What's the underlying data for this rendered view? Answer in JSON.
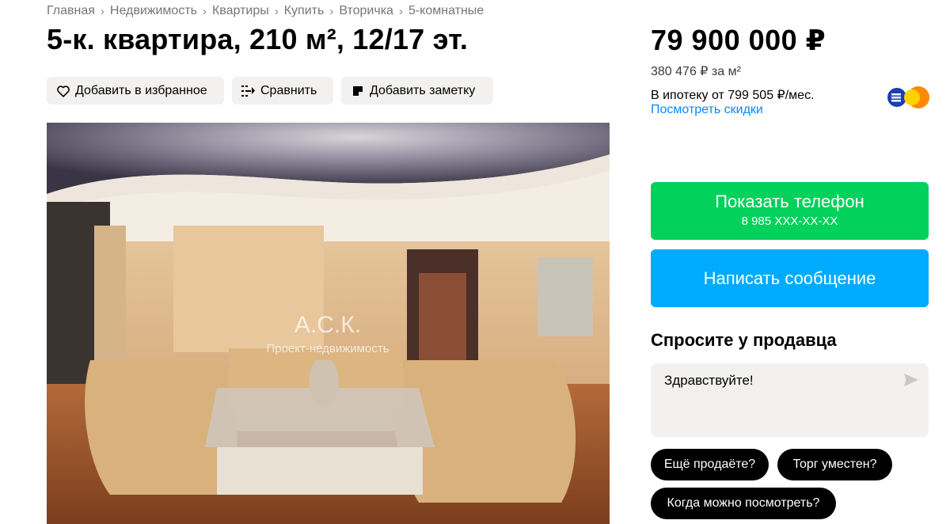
{
  "breadcrumb": [
    "Главная",
    "Недвижимость",
    "Квартиры",
    "Купить",
    "Вторичка",
    "5-комнатные"
  ],
  "listing": {
    "title": "5-к. квартира, 210 м², 12/17 эт."
  },
  "actions": {
    "favorite": "Добавить в избранное",
    "compare": "Сравнить",
    "note": "Добавить заметку"
  },
  "photo": {
    "watermark_title": "А.С.К.",
    "watermark_sub": "Проект-недвижимость"
  },
  "price": {
    "total": "79 900 000 ₽",
    "per_m2": "380 476 ₽ за м²",
    "mortgage": "В ипотеку от 799 505 ₽/мес.",
    "discounts_link": "Посмотреть скидки"
  },
  "contact": {
    "show_phone": "Показать телефон",
    "phone_masked": "8 985 XXX-XX-XX",
    "write_message": "Написать сообщение"
  },
  "ask_seller": {
    "title": "Спросите у продавца",
    "message_value": "Здравствуйте!",
    "chips": [
      "Ещё продаёте?",
      "Торг уместен?",
      "Когда можно посмотреть?"
    ]
  },
  "colors": {
    "green": "#02d15c",
    "blue": "#00aaff",
    "link": "#0a88ff",
    "chip": "#000000",
    "action_bg": "#f2f1f0"
  },
  "icons": {
    "favorite": "heart-icon",
    "compare": "compare-icon",
    "note": "note-icon",
    "send": "send-icon",
    "bank": "bank-logo-icon",
    "breadcrumb_sep": "chevron-right-icon"
  }
}
